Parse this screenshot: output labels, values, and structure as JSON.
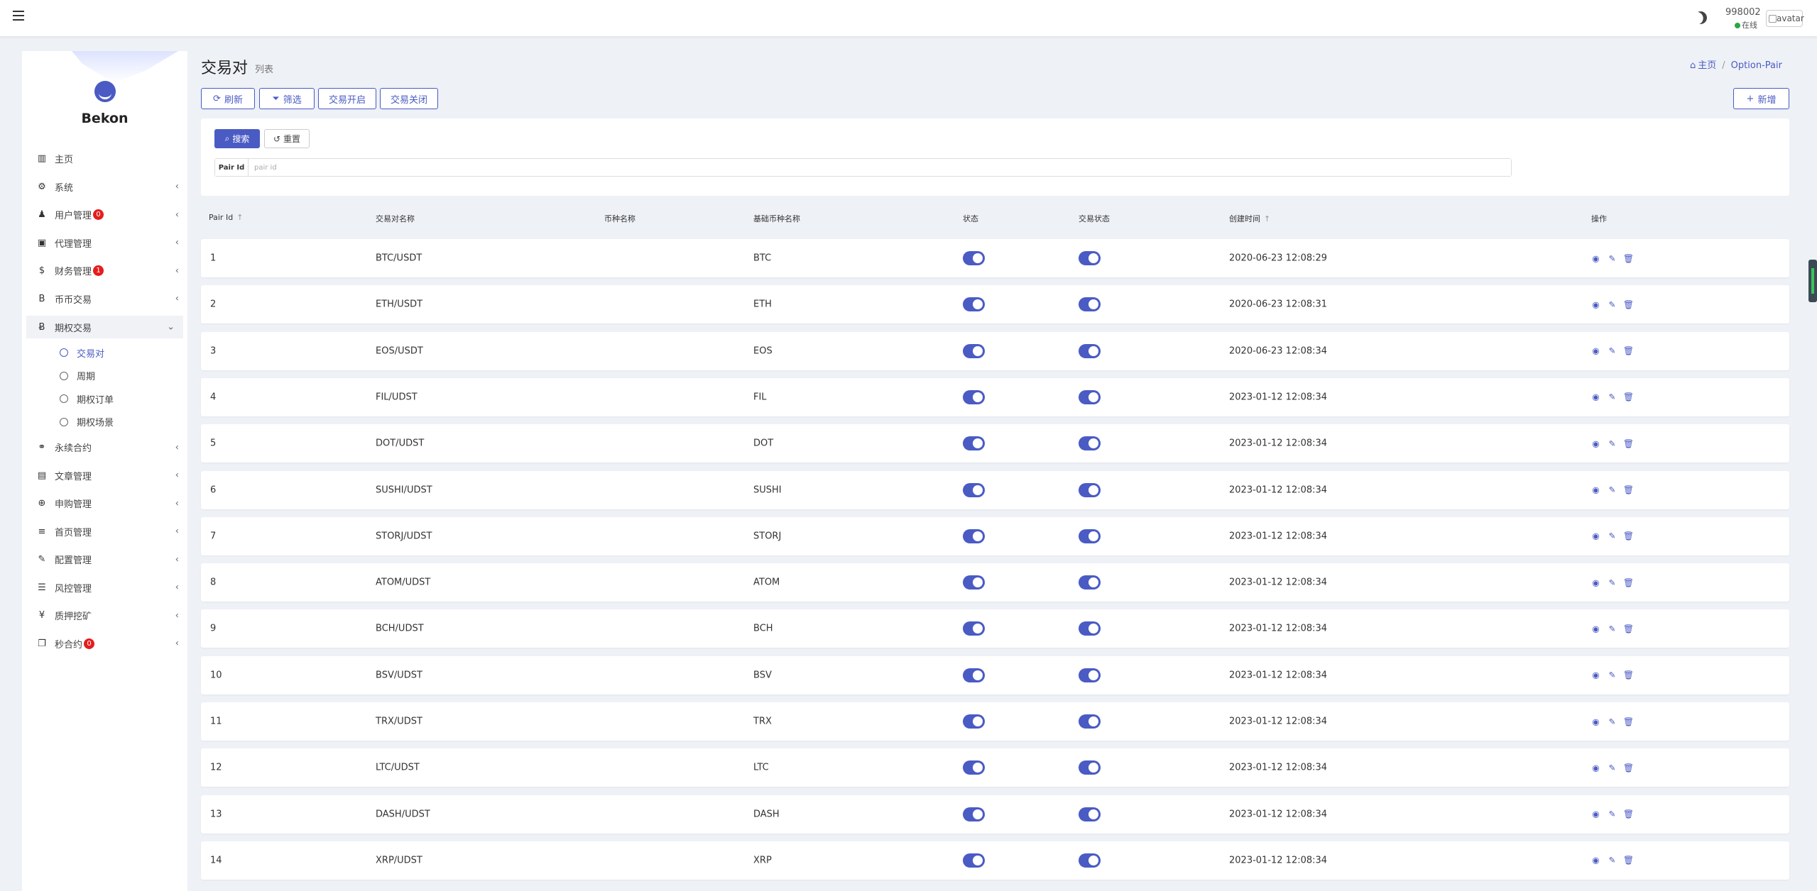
{
  "topbar": {
    "user_id": "998002",
    "status": "在线",
    "avatar_alt": "avatar"
  },
  "sidebar": {
    "brand": "Bekon",
    "items": [
      {
        "label": "主页",
        "icon": "chart-icon",
        "glyph": "▥",
        "name": "home",
        "chevron": false
      },
      {
        "label": "系统",
        "icon": "gear-icon",
        "glyph": "⚙",
        "name": "system",
        "chevron": true
      },
      {
        "label": "用户管理",
        "icon": "users-icon",
        "glyph": "♟",
        "name": "users",
        "chevron": true,
        "badge": "0"
      },
      {
        "label": "代理管理",
        "icon": "id-card-icon",
        "glyph": "▣",
        "name": "agents",
        "chevron": true
      },
      {
        "label": "财务管理",
        "icon": "dollar-icon",
        "glyph": "$",
        "name": "finance",
        "chevron": true,
        "badge": "1"
      },
      {
        "label": "币币交易",
        "icon": "bitcoin-icon",
        "glyph": "B",
        "name": "spot",
        "chevron": true
      },
      {
        "label": "期权交易",
        "icon": "bitcoin-icon",
        "glyph": "Ƀ",
        "name": "options",
        "chevron": true,
        "open": true,
        "children": [
          {
            "label": "交易对",
            "active": true,
            "name": "pairs"
          },
          {
            "label": "周期",
            "name": "period"
          },
          {
            "label": "期权订单",
            "name": "orders"
          },
          {
            "label": "期权场景",
            "name": "scenes"
          }
        ]
      },
      {
        "label": "永续合约",
        "icon": "link-icon",
        "glyph": "⚭",
        "name": "perpetual",
        "chevron": true
      },
      {
        "label": "文章管理",
        "icon": "newspaper-icon",
        "glyph": "▤",
        "name": "articles",
        "chevron": true
      },
      {
        "label": "申购管理",
        "icon": "lifebuoy-icon",
        "glyph": "⊕",
        "name": "subscription",
        "chevron": true
      },
      {
        "label": "首页管理",
        "icon": "bars-icon",
        "glyph": "≡",
        "name": "homepage",
        "chevron": true
      },
      {
        "label": "配置管理",
        "icon": "wrench-icon",
        "glyph": "✎",
        "name": "config",
        "chevron": true
      },
      {
        "label": "风控管理",
        "icon": "list-icon",
        "glyph": "☰",
        "name": "risk",
        "chevron": true
      },
      {
        "label": "质押挖矿",
        "icon": "yen-icon",
        "glyph": "¥",
        "name": "staking",
        "chevron": true
      },
      {
        "label": "秒合约",
        "icon": "copy-icon",
        "glyph": "❐",
        "name": "seconds",
        "chevron": true,
        "badge": "0"
      }
    ]
  },
  "header": {
    "title": "交易对",
    "subtitle": "列表",
    "breadcrumb": {
      "home": "主页",
      "current": "Option-Pair"
    }
  },
  "toolbar": {
    "refresh": "刷新",
    "filter": "筛选",
    "trade_open": "交易开启",
    "trade_close": "交易关闭",
    "add": "新增"
  },
  "search": {
    "search_label": "搜索",
    "reset_label": "重置",
    "field_label": "Pair Id",
    "field_placeholder": "pair id",
    "field_value": ""
  },
  "table": {
    "columns": [
      "Pair Id",
      "交易对名称",
      "币种名称",
      "基础币种名称",
      "状态",
      "交易状态",
      "创建时间",
      "操作"
    ],
    "rows": [
      {
        "id": "1",
        "pair": "BTC/USDT",
        "coin": "",
        "base": "BTC",
        "status": true,
        "trade_status": true,
        "created": "2020-06-23 12:08:29"
      },
      {
        "id": "2",
        "pair": "ETH/USDT",
        "coin": "",
        "base": "ETH",
        "status": true,
        "trade_status": true,
        "created": "2020-06-23 12:08:31"
      },
      {
        "id": "3",
        "pair": "EOS/USDT",
        "coin": "",
        "base": "EOS",
        "status": true,
        "trade_status": true,
        "created": "2020-06-23 12:08:34"
      },
      {
        "id": "4",
        "pair": "FIL/UDST",
        "coin": "",
        "base": "FIL",
        "status": true,
        "trade_status": true,
        "created": "2023-01-12 12:08:34"
      },
      {
        "id": "5",
        "pair": "DOT/UDST",
        "coin": "",
        "base": "DOT",
        "status": true,
        "trade_status": true,
        "created": "2023-01-12 12:08:34"
      },
      {
        "id": "6",
        "pair": "SUSHI/UDST",
        "coin": "",
        "base": "SUSHI",
        "status": true,
        "trade_status": true,
        "created": "2023-01-12 12:08:34"
      },
      {
        "id": "7",
        "pair": "STORJ/UDST",
        "coin": "",
        "base": "STORJ",
        "status": true,
        "trade_status": true,
        "created": "2023-01-12 12:08:34"
      },
      {
        "id": "8",
        "pair": "ATOM/UDST",
        "coin": "",
        "base": "ATOM",
        "status": true,
        "trade_status": true,
        "created": "2023-01-12 12:08:34"
      },
      {
        "id": "9",
        "pair": "BCH/UDST",
        "coin": "",
        "base": "BCH",
        "status": true,
        "trade_status": true,
        "created": "2023-01-12 12:08:34"
      },
      {
        "id": "10",
        "pair": "BSV/UDST",
        "coin": "",
        "base": "BSV",
        "status": true,
        "trade_status": true,
        "created": "2023-01-12 12:08:34"
      },
      {
        "id": "11",
        "pair": "TRX/UDST",
        "coin": "",
        "base": "TRX",
        "status": true,
        "trade_status": true,
        "created": "2023-01-12 12:08:34"
      },
      {
        "id": "12",
        "pair": "LTC/UDST",
        "coin": "",
        "base": "LTC",
        "status": true,
        "trade_status": true,
        "created": "2023-01-12 12:08:34"
      },
      {
        "id": "13",
        "pair": "DASH/UDST",
        "coin": "",
        "base": "DASH",
        "status": true,
        "trade_status": true,
        "created": "2023-01-12 12:08:34"
      },
      {
        "id": "14",
        "pair": "XRP/UDST",
        "coin": "",
        "base": "XRP",
        "status": true,
        "trade_status": true,
        "created": "2023-01-12 12:08:34"
      }
    ]
  },
  "colors": {
    "accent": "#4a5bc4",
    "badge": "#e61d1d",
    "online": "#28a745",
    "background": "#eef1f6"
  }
}
